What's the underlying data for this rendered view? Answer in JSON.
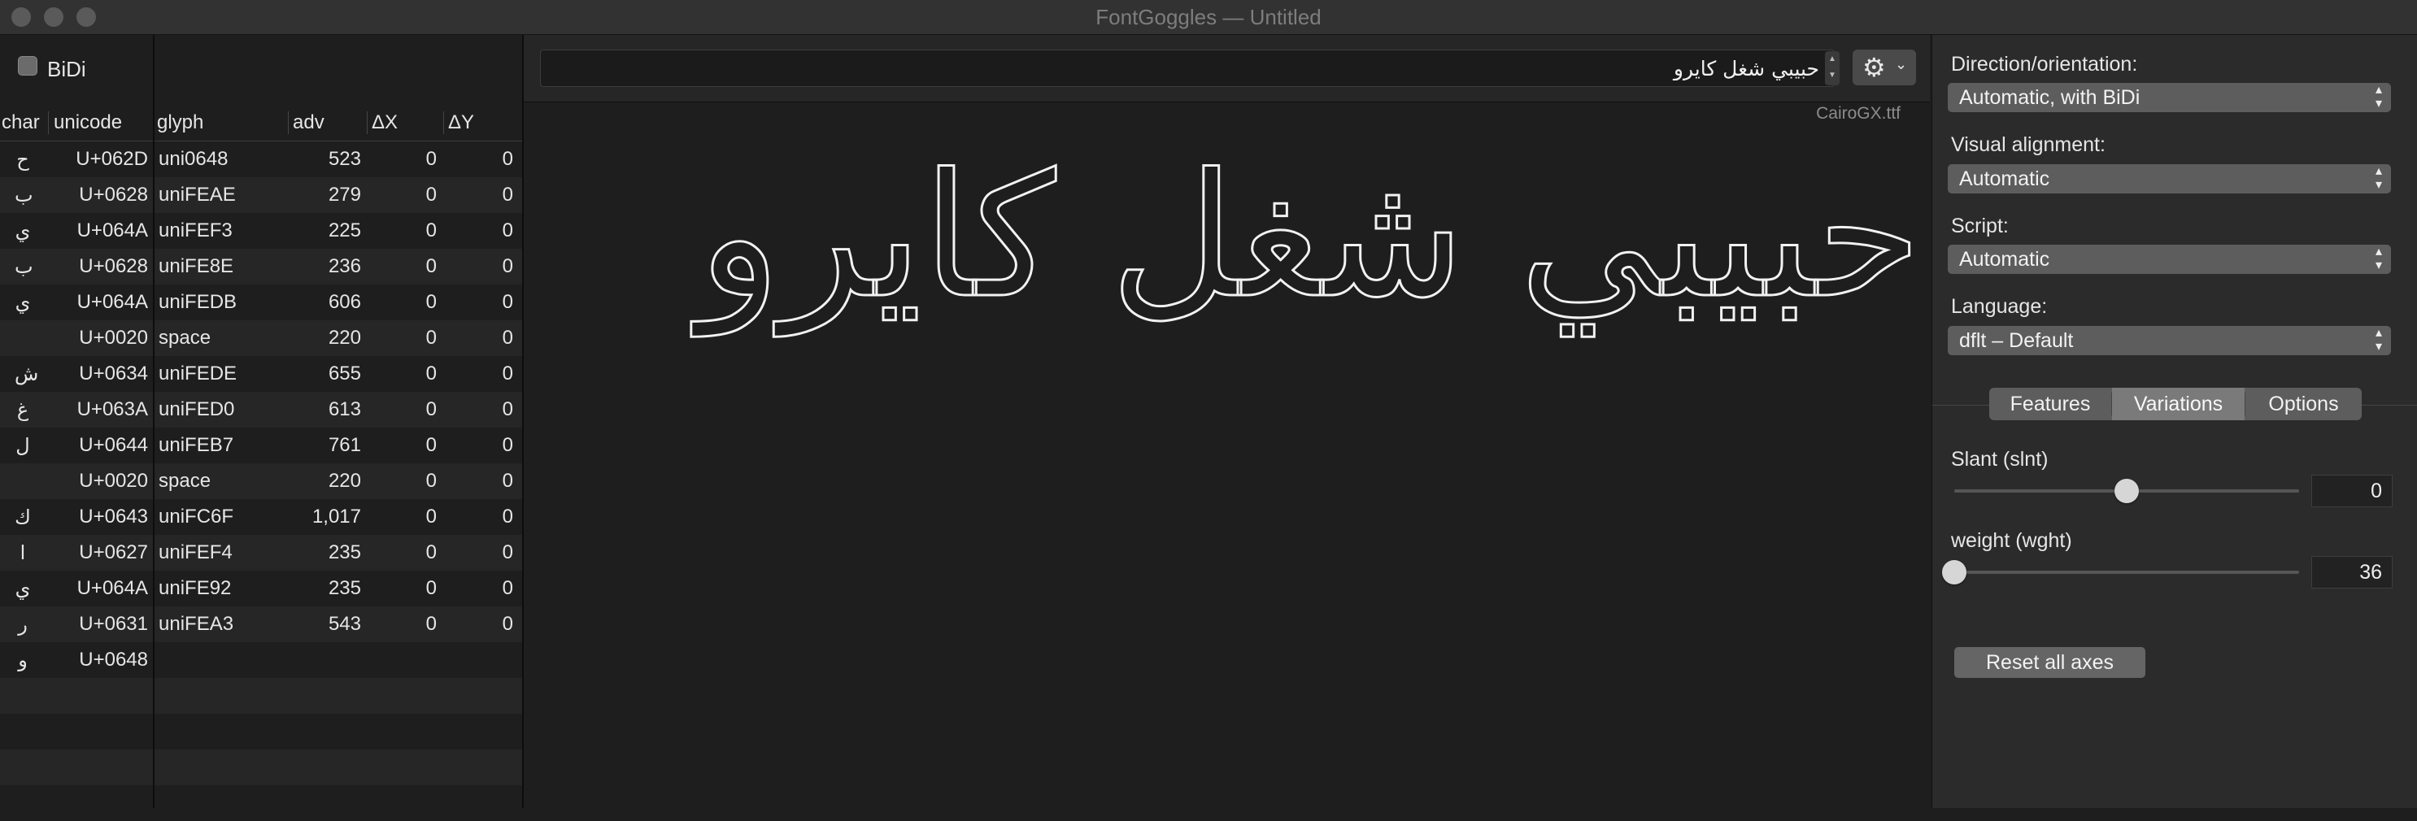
{
  "window": {
    "title": "FontGoggles — Untitled"
  },
  "bidi": {
    "label": "BiDi",
    "checked": false
  },
  "char_table": {
    "headers": {
      "char": "char",
      "unicode": "unicode"
    },
    "rows": [
      {
        "char": "ح",
        "unicode": "U+062D"
      },
      {
        "char": "ب",
        "unicode": "U+0628"
      },
      {
        "char": "ي",
        "unicode": "U+064A"
      },
      {
        "char": "ب",
        "unicode": "U+0628"
      },
      {
        "char": "ي",
        "unicode": "U+064A"
      },
      {
        "char": "",
        "unicode": "U+0020"
      },
      {
        "char": "ش",
        "unicode": "U+0634"
      },
      {
        "char": "غ",
        "unicode": "U+063A"
      },
      {
        "char": "ل",
        "unicode": "U+0644"
      },
      {
        "char": "",
        "unicode": "U+0020"
      },
      {
        "char": "ك",
        "unicode": "U+0643"
      },
      {
        "char": "ا",
        "unicode": "U+0627"
      },
      {
        "char": "ي",
        "unicode": "U+064A"
      },
      {
        "char": "ر",
        "unicode": "U+0631"
      },
      {
        "char": "و",
        "unicode": "U+0648"
      }
    ]
  },
  "glyph_table": {
    "headers": {
      "glyph": "glyph",
      "adv": "adv",
      "dx": "ΔX",
      "dy": "ΔY"
    },
    "rows": [
      {
        "glyph": "uni0648",
        "adv": "523",
        "dx": "0",
        "dy": "0"
      },
      {
        "glyph": "uniFEAE",
        "adv": "279",
        "dx": "0",
        "dy": "0"
      },
      {
        "glyph": "uniFEF3",
        "adv": "225",
        "dx": "0",
        "dy": "0"
      },
      {
        "glyph": "uniFE8E",
        "adv": "236",
        "dx": "0",
        "dy": "0"
      },
      {
        "glyph": "uniFEDB",
        "adv": "606",
        "dx": "0",
        "dy": "0"
      },
      {
        "glyph": "space",
        "adv": "220",
        "dx": "0",
        "dy": "0"
      },
      {
        "glyph": "uniFEDE",
        "adv": "655",
        "dx": "0",
        "dy": "0"
      },
      {
        "glyph": "uniFED0",
        "adv": "613",
        "dx": "0",
        "dy": "0"
      },
      {
        "glyph": "uniFEB7",
        "adv": "761",
        "dx": "0",
        "dy": "0"
      },
      {
        "glyph": "space",
        "adv": "220",
        "dx": "0",
        "dy": "0"
      },
      {
        "glyph": "uniFC6F",
        "adv": "1,017",
        "dx": "0",
        "dy": "0"
      },
      {
        "glyph": "uniFEF4",
        "adv": "235",
        "dx": "0",
        "dy": "0"
      },
      {
        "glyph": "uniFE92",
        "adv": "235",
        "dx": "0",
        "dy": "0"
      },
      {
        "glyph": "uniFEA3",
        "adv": "543",
        "dx": "0",
        "dy": "0"
      }
    ]
  },
  "text_entry": {
    "value": "حبيبي شغل كايرو"
  },
  "icons": {
    "gear": "gear-icon",
    "chevron": "chevron-down-icon",
    "stepper": "stepper-icon"
  },
  "preview": {
    "font_file": "CairoGX.ttf",
    "text": "حبيبي شغل كايرو"
  },
  "sidebar": {
    "direction": {
      "label": "Direction/orientation:",
      "value": "Automatic, with BiDi"
    },
    "alignment": {
      "label": "Visual alignment:",
      "value": "Automatic"
    },
    "script": {
      "label": "Script:",
      "value": "Automatic"
    },
    "language": {
      "label": "Language:",
      "value": "dflt – Default"
    },
    "tabs": [
      {
        "label": "Features",
        "selected": false
      },
      {
        "label": "Variations",
        "selected": true
      },
      {
        "label": "Options",
        "selected": false
      }
    ],
    "axes": [
      {
        "label": "Slant (slnt)",
        "value": "0",
        "level": 0.5
      },
      {
        "label": "weight (wght)",
        "value": "36",
        "level": 0.0
      }
    ],
    "reset_label": "Reset all axes"
  }
}
